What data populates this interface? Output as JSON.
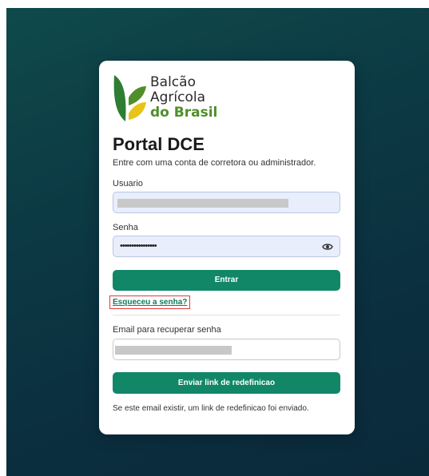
{
  "brand": {
    "line1": "Balcão",
    "line2": "Agrícola",
    "line3": "do Brasil",
    "colors": {
      "dark_green": "#2e7d32",
      "yellow": "#e6c418",
      "text_green": "#4f8e2a"
    }
  },
  "login": {
    "title": "Portal DCE",
    "subtitle": "Entre com uma conta de corretora ou administrador.",
    "username_label": "Usuario",
    "password_label": "Senha",
    "password_value": "••••••••••••••••",
    "submit_label": "Entrar",
    "forgot_link": "Esqueceu a senha?"
  },
  "recovery": {
    "email_label": "Email para recuperar senha",
    "submit_label": "Enviar link de redefinicao",
    "confirmation": "Se este email existir, um link de redefinicao foi enviado."
  },
  "theme": {
    "accent": "#118768",
    "highlight_border": "#e03a3a"
  }
}
